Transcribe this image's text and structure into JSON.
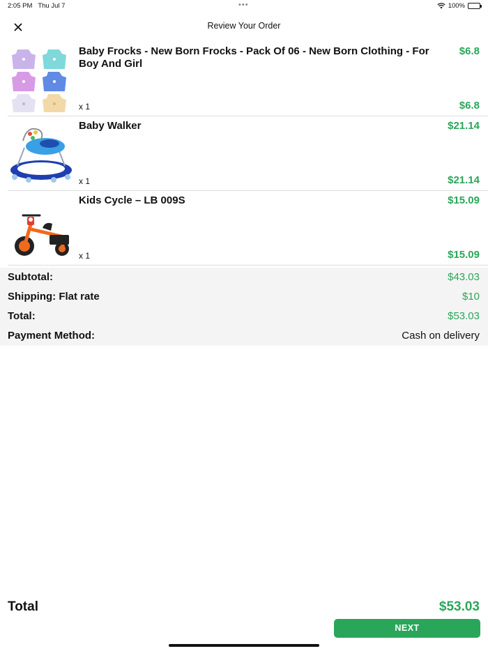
{
  "status_bar": {
    "time": "2:05 PM",
    "date": "Thu Jul 7",
    "dots": "•••",
    "battery": "100%",
    "wifi_icon": "wifi-icon",
    "battery_icon": "battery-icon"
  },
  "navbar": {
    "title": "Review Your Order",
    "close_icon": "close-icon"
  },
  "items": [
    {
      "name": "Baby Frocks - New Born Frocks - Pack Of 06 - New Born Clothing - For Boy And Girl",
      "price": "$6.8",
      "qty": "x 1",
      "total": "$6.8"
    },
    {
      "name": "Baby Walker",
      "price": "$21.14",
      "qty": "x 1",
      "total": "$21.14"
    },
    {
      "name": "Kids Cycle – LB 009S",
      "price": "$15.09",
      "qty": "x 1",
      "total": "$15.09"
    }
  ],
  "summary": {
    "subtotal_label": "Subtotal:",
    "subtotal_value": "$43.03",
    "shipping_label": "Shipping: Flat rate",
    "shipping_value": "$10",
    "total_label": "Total:",
    "total_value": "$53.03",
    "payment_label": "Payment Method:",
    "payment_value": "Cash on delivery"
  },
  "footer": {
    "total_label": "Total",
    "total_value": "$53.03",
    "next_label": "NEXT"
  },
  "colors": {
    "accent": "#2aa65a",
    "summary_bg": "#f4f4f4",
    "divider": "#dcdcdc"
  }
}
